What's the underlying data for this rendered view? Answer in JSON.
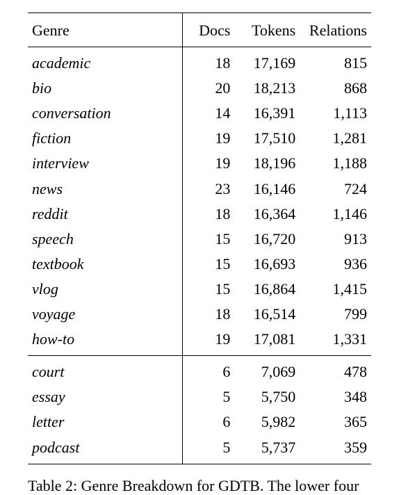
{
  "headers": {
    "genre": "Genre",
    "docs": "Docs",
    "tokens": "Tokens",
    "relations": "Relations"
  },
  "rows_top": [
    {
      "genre": "academic",
      "docs": "18",
      "tokens": "17,169",
      "relations": "815"
    },
    {
      "genre": "bio",
      "docs": "20",
      "tokens": "18,213",
      "relations": "868"
    },
    {
      "genre": "conversation",
      "docs": "14",
      "tokens": "16,391",
      "relations": "1,113"
    },
    {
      "genre": "fiction",
      "docs": "19",
      "tokens": "17,510",
      "relations": "1,281"
    },
    {
      "genre": "interview",
      "docs": "19",
      "tokens": "18,196",
      "relations": "1,188"
    },
    {
      "genre": "news",
      "docs": "23",
      "tokens": "16,146",
      "relations": "724"
    },
    {
      "genre": "reddit",
      "docs": "18",
      "tokens": "16,364",
      "relations": "1,146"
    },
    {
      "genre": "speech",
      "docs": "15",
      "tokens": "16,720",
      "relations": "913"
    },
    {
      "genre": "textbook",
      "docs": "15",
      "tokens": "16,693",
      "relations": "936"
    },
    {
      "genre": "vlog",
      "docs": "15",
      "tokens": "16,864",
      "relations": "1,415"
    },
    {
      "genre": "voyage",
      "docs": "18",
      "tokens": "16,514",
      "relations": "799"
    },
    {
      "genre": "how-to",
      "docs": "19",
      "tokens": "17,081",
      "relations": "1,331"
    }
  ],
  "rows_bottom": [
    {
      "genre": "court",
      "docs": "6",
      "tokens": "7,069",
      "relations": "478"
    },
    {
      "genre": "essay",
      "docs": "5",
      "tokens": "5,750",
      "relations": "348"
    },
    {
      "genre": "letter",
      "docs": "6",
      "tokens": "5,982",
      "relations": "365"
    },
    {
      "genre": "podcast",
      "docs": "5",
      "tokens": "5,737",
      "relations": "359"
    }
  ],
  "caption": "Table 2: Genre Breakdown for GDTB. The lower four"
}
